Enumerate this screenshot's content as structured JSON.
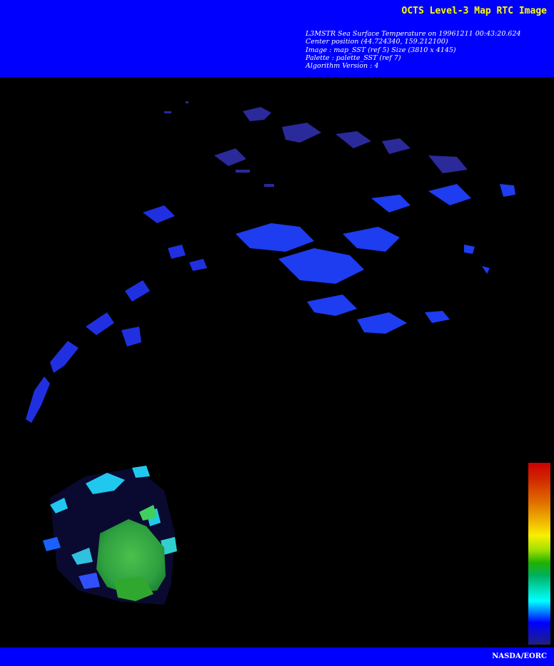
{
  "header": {
    "title": "OCTS Level-3 Map RTC Image",
    "meta_lines": [
      "L3MSTR Sea Surface Temperature on 19961211 00:43:20.624",
      "Center position (44.724340, 159.212100)",
      "Image : map_SST (ref 5) Size (3810 x 4145)",
      "Palette : palette_SST (ref 7)",
      "Algorithm Version : 4"
    ]
  },
  "colors": {
    "banner": "#0000ff",
    "title_text": "#ffff00",
    "meta_text": "#ffffff",
    "background": "#000000"
  },
  "colorbar": {
    "palette": "palette_SST"
  },
  "footer": {
    "credit": "NASDA/EORC"
  }
}
